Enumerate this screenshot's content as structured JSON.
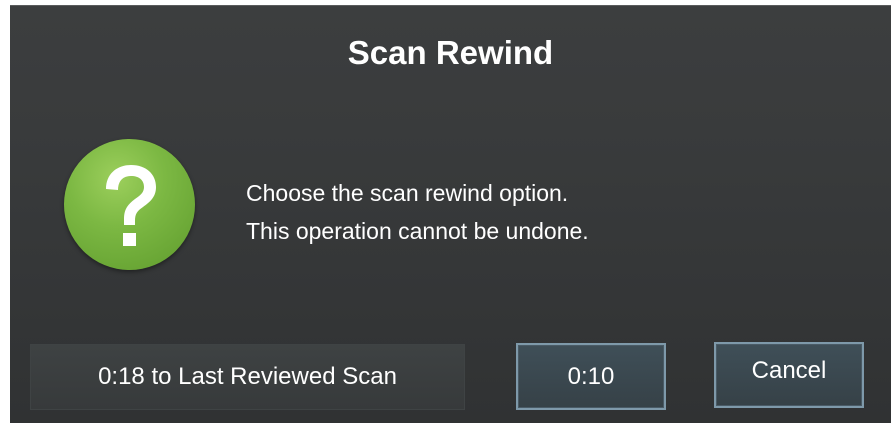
{
  "dialog": {
    "title": "Scan Rewind",
    "icon": "question-mark-icon",
    "message_line1": "Choose the scan rewind option.",
    "message_line2": "This operation cannot be undone."
  },
  "buttons": {
    "last_reviewed_label": "0:18 to Last Reviewed Scan",
    "ten_seconds_label": "0:10",
    "cancel_label": "Cancel"
  },
  "colors": {
    "dialog_background": "#363839",
    "icon_green": "#7cb843",
    "button_border": "#7e99aa",
    "text": "#ffffff"
  }
}
